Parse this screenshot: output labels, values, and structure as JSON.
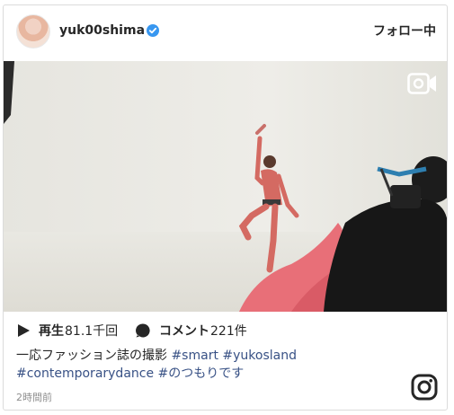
{
  "post": {
    "username": "yuk00shima",
    "follow_label": "フォロー中",
    "views_label": "再生",
    "views_count": "81.1千回",
    "comments_label": "コメント",
    "comments_count": "221件",
    "caption_text": "一応ファッション誌の撮影",
    "hashtags": [
      "#smart",
      "#yukosland",
      "#contemporarydance",
      "#のつもりです"
    ],
    "timestamp": "2時間前"
  },
  "icons": {
    "verified": "verified-badge-icon",
    "video": "video-camera-icon",
    "play": "play-icon",
    "comment": "comment-bubble-icon",
    "logo": "instagram-logo-icon"
  },
  "colors": {
    "text": "#262626",
    "hashtag": "#385185",
    "verified": "#3897f0",
    "muted": "#8e8e8e",
    "border": "#dbdbdb"
  }
}
